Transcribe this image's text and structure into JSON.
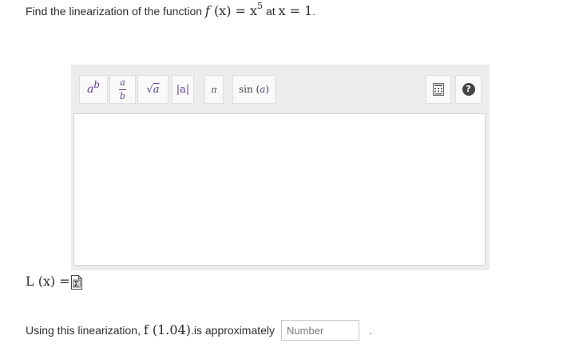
{
  "question": {
    "prefix": "Find the linearization of the function",
    "func_name": "f",
    "func_arg": "(x) = x",
    "exponent": "5",
    "at_text": "at",
    "point": "x = 1",
    "period": "."
  },
  "toolbar": {
    "power": {
      "base": "a",
      "exp": "b"
    },
    "fraction": {
      "num": "a",
      "den": "b"
    },
    "sqrt": {
      "radical": "√",
      "arg": "a"
    },
    "abs": "|a|",
    "pi": "π",
    "sin": {
      "fn": "sin",
      "open": " (",
      "arg": "a",
      "close": ")"
    },
    "help": "?"
  },
  "answer_label": "L (x) =",
  "followup": {
    "prefix": "Using this linearization,",
    "expr": "f (1.04)",
    "suffix": ".is approximately",
    "input_placeholder": "Number",
    "trailing": "."
  },
  "colors": {
    "editor_bg": "#ececec",
    "math_accent": "#5a3d8c",
    "text": "#2d2d2d"
  },
  "icons": [
    "keyboard-icon",
    "help-icon",
    "document-sigma-icon"
  ]
}
